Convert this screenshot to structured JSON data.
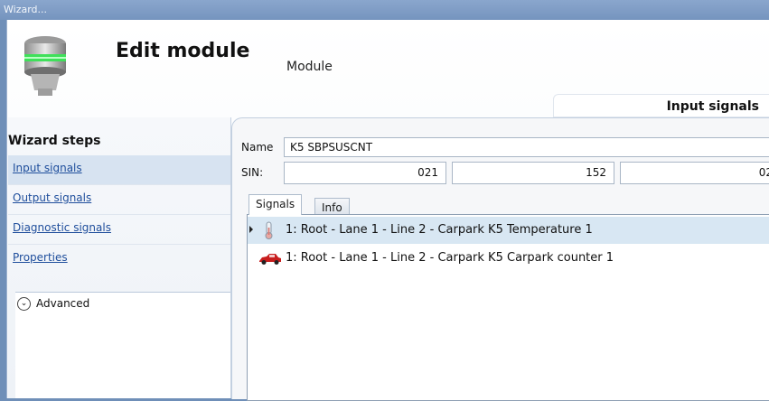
{
  "window": {
    "title": "Wizard..."
  },
  "header": {
    "title": "Edit module",
    "subtitle": "Module",
    "current_step": "Input signals"
  },
  "sidebar": {
    "title": "Wizard steps",
    "steps": [
      {
        "label": "Input signals"
      },
      {
        "label": "Output signals"
      },
      {
        "label": "Diagnostic signals"
      },
      {
        "label": "Properties"
      }
    ],
    "advanced_label": "Advanced"
  },
  "form": {
    "name_label": "Name",
    "name_value": "K5 SBPSUSCNT",
    "sin_label": "SIN:",
    "sin_values": [
      "021",
      "152",
      "02"
    ]
  },
  "tabs": [
    {
      "label": "Signals"
    },
    {
      "label": "Info"
    }
  ],
  "signals": [
    {
      "icon": "thermometer-icon",
      "text": "1: Root - Lane 1 - Line 2 - Carpark K5 Temperature 1"
    },
    {
      "icon": "car-icon",
      "text": "1: Root - Lane 1 - Line 2 - Carpark K5 Carpark counter 1"
    }
  ],
  "colors": {
    "selected_row": "#d8e7f3",
    "link": "#1f4e9c",
    "title_bar": "#7d9ac3"
  }
}
